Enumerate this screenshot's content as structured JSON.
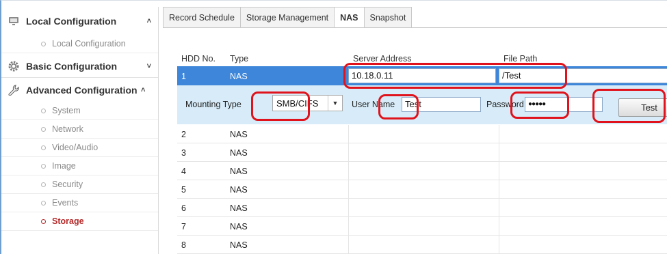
{
  "sidebar": {
    "local_configuration": {
      "title": "Local Configuration",
      "items": [
        "Local Configuration"
      ]
    },
    "basic_configuration": {
      "title": "Basic Configuration"
    },
    "advanced_configuration": {
      "title": "Advanced Configuration",
      "items": [
        "System",
        "Network",
        "Video/Audio",
        "Image",
        "Security",
        "Events",
        "Storage"
      ],
      "active_item": "Storage"
    }
  },
  "tabs": [
    "Record Schedule",
    "Storage Management",
    "NAS",
    "Snapshot"
  ],
  "active_tab": "NAS",
  "table": {
    "headers": [
      "HDD No.",
      "Type",
      "Server Address",
      "File Path"
    ],
    "selected": {
      "hdd_no": "1",
      "type": "NAS",
      "server_address": "10.18.0.11",
      "file_path": "/Test"
    },
    "mounting": {
      "mounting_type_label": "Mounting Type",
      "mounting_type_value": "SMB/CIFS",
      "user_name_label": "User Name",
      "user_name_value": "Test",
      "password_label": "Password",
      "password_mask": "●●●●●",
      "test_button": "Test"
    },
    "rows": [
      {
        "hdd_no": "2",
        "type": "NAS"
      },
      {
        "hdd_no": "3",
        "type": "NAS"
      },
      {
        "hdd_no": "4",
        "type": "NAS"
      },
      {
        "hdd_no": "5",
        "type": "NAS"
      },
      {
        "hdd_no": "6",
        "type": "NAS"
      },
      {
        "hdd_no": "7",
        "type": "NAS"
      },
      {
        "hdd_no": "8",
        "type": "NAS"
      }
    ]
  },
  "icons": {
    "local": "monitor-icon",
    "basic": "gear-icon",
    "advanced": "wrench-icon"
  },
  "colors": {
    "selected_row": "#3d86d9",
    "mount_panel": "#d7ecf8",
    "active_menu": "#b52a2a",
    "highlight": "#e0121b"
  }
}
